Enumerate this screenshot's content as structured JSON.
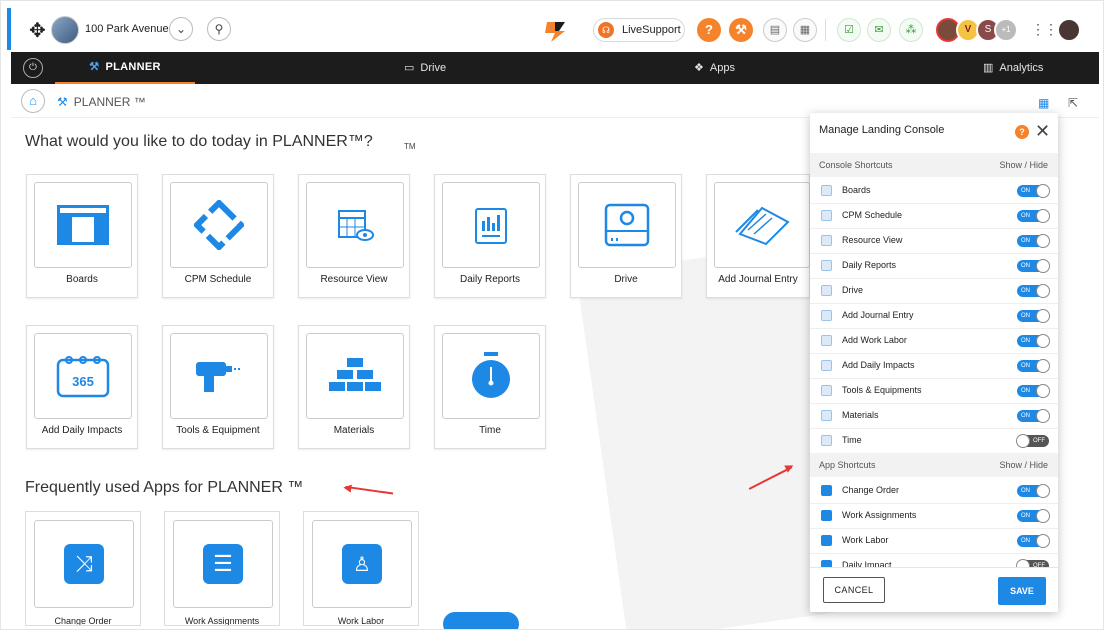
{
  "header": {
    "project_name": "100 Park Avenue",
    "live_support": "LiveSupport",
    "overflow_count": "+1",
    "avatar_initial": "S"
  },
  "nav": {
    "active": "PLANNER",
    "drive": "Drive",
    "apps": "Apps",
    "analytics": "Analytics"
  },
  "breadcrumb": {
    "title": "PLANNER ™"
  },
  "main": {
    "heading": "What would you like to do today in PLANNER™?",
    "tm_mark": "TM",
    "tiles": [
      {
        "label": "Boards"
      },
      {
        "label": "CPM Schedule"
      },
      {
        "label": "Resource View"
      },
      {
        "label": "Daily Reports"
      },
      {
        "label": "Drive"
      },
      {
        "label": "Add Journal Entry"
      },
      {
        "label": "Add Daily Impacts"
      },
      {
        "label": "Tools & Equipment"
      },
      {
        "label": "Materials"
      },
      {
        "label": "Time"
      }
    ],
    "frequent_heading": "Frequently used Apps for PLANNER ™",
    "apps": [
      {
        "label": "Change Order"
      },
      {
        "label": "Work Assignments"
      },
      {
        "label": "Work Labor"
      }
    ]
  },
  "panel": {
    "title": "Manage Landing Console",
    "console_header": "Console Shortcuts",
    "app_header": "App Shortcuts",
    "show_hide": "Show / Hide",
    "on_label": "ON",
    "off_label": "OFF",
    "console_rows": [
      {
        "name": "Boards",
        "on": true
      },
      {
        "name": "CPM Schedule",
        "on": true
      },
      {
        "name": "Resource View",
        "on": true
      },
      {
        "name": "Daily Reports",
        "on": true
      },
      {
        "name": "Drive",
        "on": true
      },
      {
        "name": "Add Journal Entry",
        "on": true
      },
      {
        "name": "Add Work Labor",
        "on": true
      },
      {
        "name": "Add Daily Impacts",
        "on": true
      },
      {
        "name": "Tools & Equipments",
        "on": true
      },
      {
        "name": "Materials",
        "on": true
      },
      {
        "name": "Time",
        "on": false
      }
    ],
    "app_rows": [
      {
        "name": "Change Order",
        "on": true
      },
      {
        "name": "Work Assignments",
        "on": true
      },
      {
        "name": "Work Labor",
        "on": true
      },
      {
        "name": "Daily Impact",
        "on": false
      }
    ],
    "cancel": "CANCEL",
    "save": "SAVE"
  },
  "colors": {
    "accent": "#1e88e5",
    "orange": "#f5832b",
    "nav_bg": "#1c1c1c",
    "annotation": "#e53935"
  }
}
